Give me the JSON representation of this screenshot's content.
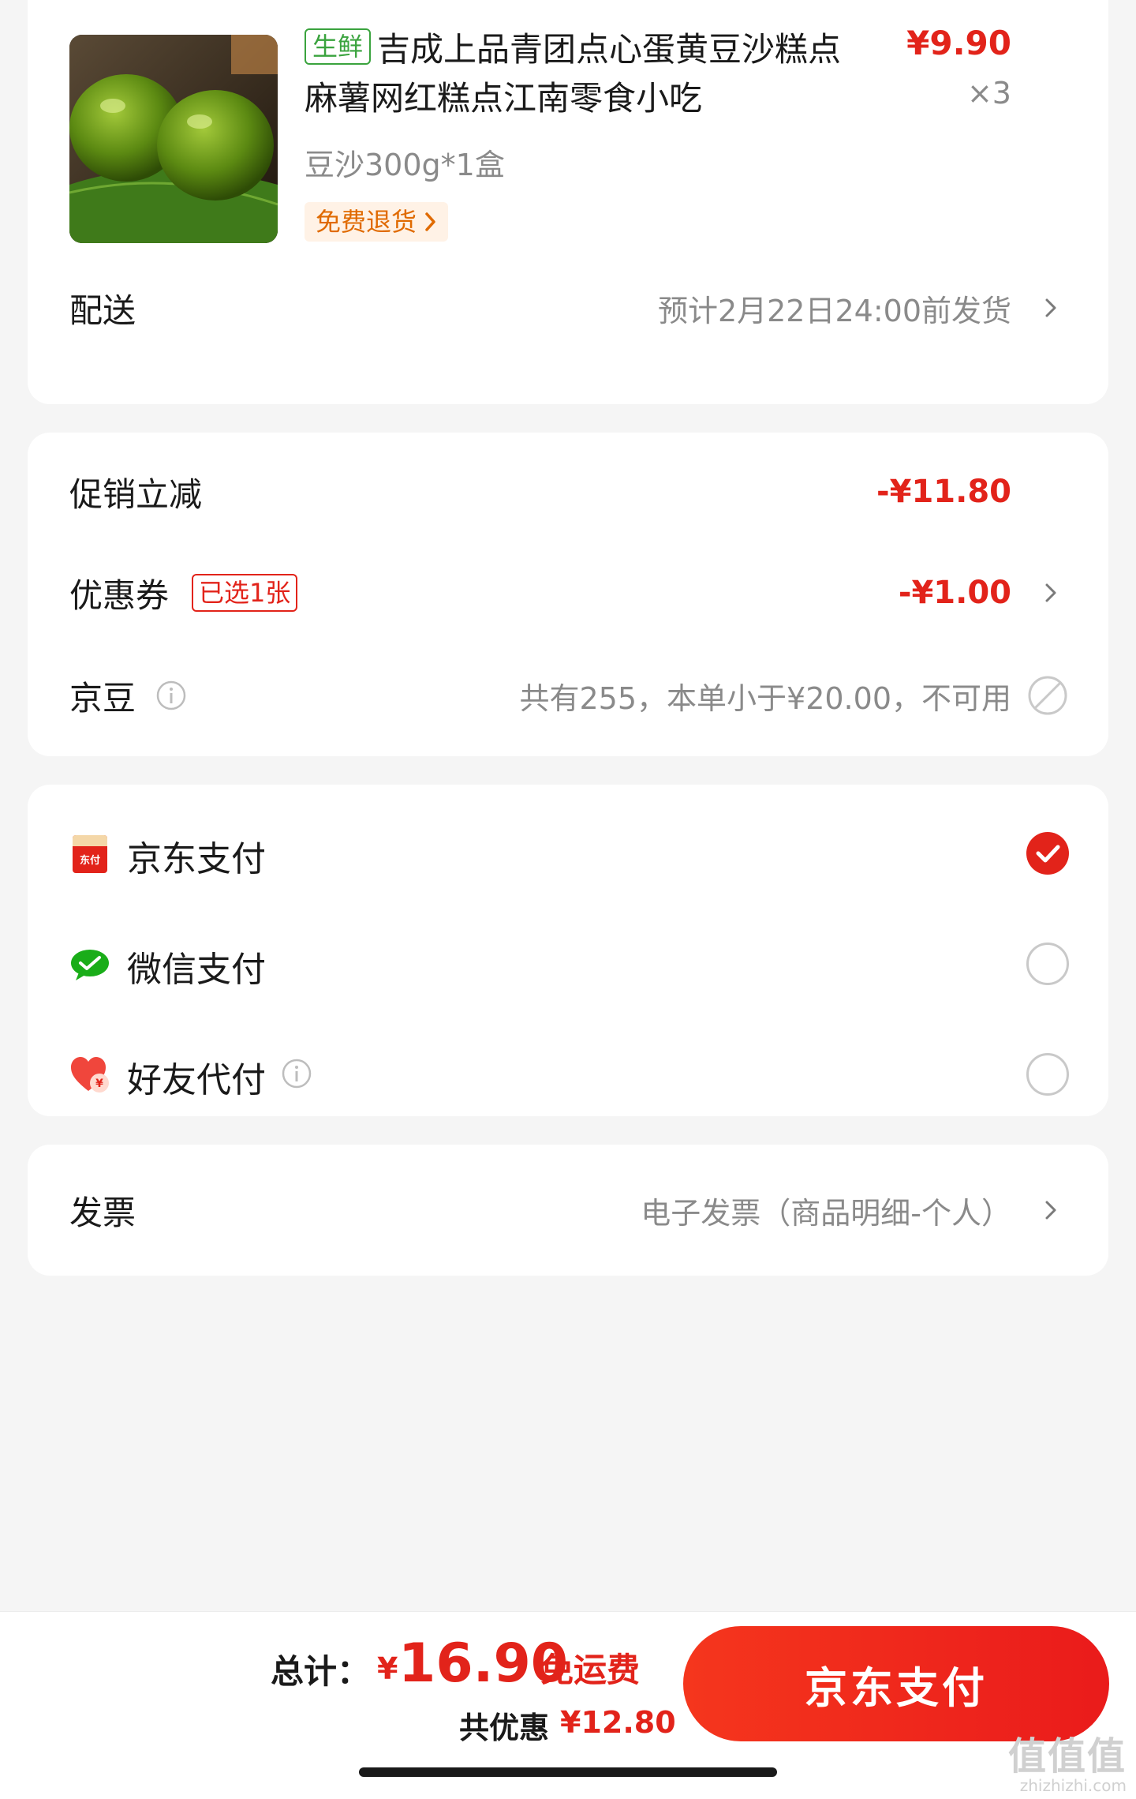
{
  "product": {
    "tag": "生鲜",
    "title": "吉成上品青团点心蛋黄豆沙糕点麻薯网红糕点江南零食小吃",
    "price": "¥9.90",
    "quantity": "×3",
    "spec": "豆沙300g*1盒",
    "return_badge": "免费退货"
  },
  "delivery": {
    "label": "配送",
    "value": "预计2月22日24:00前发货"
  },
  "discounts": {
    "promo_label": "促销立减",
    "promo_value": "-¥11.80",
    "coupon_label": "优惠券",
    "coupon_badge": "已选1张",
    "coupon_value": "-¥1.00",
    "jingdou_label": "京豆",
    "jingdou_value": "共有255，本单小于¥20.00，不可用"
  },
  "payment_methods": [
    {
      "icon": "jd-pay-icon",
      "label": "京东支付",
      "selected": true
    },
    {
      "icon": "wechat-pay-icon",
      "label": "微信支付",
      "selected": false
    },
    {
      "icon": "friend-pay-icon",
      "label": "好友代付",
      "selected": false
    }
  ],
  "invoice": {
    "label": "发票",
    "value": "电子发票（商品明细-个人）"
  },
  "footer": {
    "total_label": "总计：",
    "currency": "¥",
    "total_amount": "16.90",
    "shipping": "免运费",
    "saved_label": "共优惠",
    "saved_amount": "¥12.80",
    "pay_button": "京东支付"
  },
  "watermark": {
    "brand": "值值值",
    "domain": "zhizhizhi.com"
  },
  "colors": {
    "accent": "#e2231a",
    "fresh_tag": "#3aa33e",
    "return_badge": "#e06a00",
    "background": "#f5f5f5"
  }
}
